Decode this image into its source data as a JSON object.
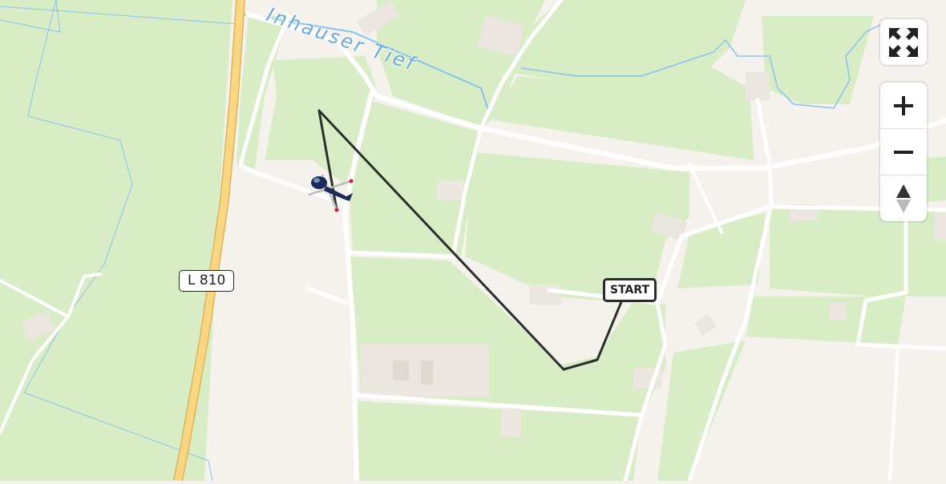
{
  "map": {
    "water_label": "Inhauser Tief",
    "road_ref": "L 810",
    "route_start_label": "START",
    "colors": {
      "land": "#f5f2ee",
      "grass": "#d8ecc6",
      "road": "#ffffff",
      "highway": "#f6cf73",
      "water": "#88c2ec",
      "route": "#2b2f2b"
    },
    "aircraft_icon": "helicopter-icon"
  },
  "controls": {
    "fullscreen_icon": "fullscreen-icon",
    "zoom_in_icon": "plus-icon",
    "zoom_out_icon": "minus-icon",
    "compass_icon": "compass-icon"
  }
}
